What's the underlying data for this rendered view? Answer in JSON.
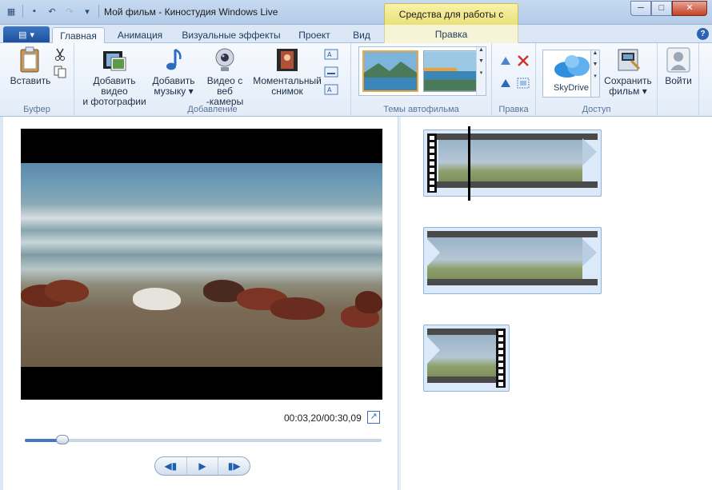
{
  "window": {
    "title": "Мой фильм - Киностудия Windows Live",
    "context_tab_header": "Средства для работы с видео"
  },
  "tabs": [
    {
      "label": "Главная",
      "active": true
    },
    {
      "label": "Анимация"
    },
    {
      "label": "Визуальные эффекты"
    },
    {
      "label": "Проект"
    },
    {
      "label": "Вид"
    },
    {
      "label": "Правка",
      "contextual": true
    }
  ],
  "ribbon": {
    "buffer": {
      "label": "Буфер",
      "paste": "Вставить"
    },
    "add": {
      "label": "Добавление",
      "add_video_1": "Добавить видео",
      "add_video_2": "и фотографии",
      "add_music_1": "Добавить",
      "add_music_2": "музыку ▾",
      "webcam_1": "Видео с веб",
      "webcam_2": "-камеры",
      "snapshot_1": "Моментальный",
      "snapshot_2": "снимок"
    },
    "themes": {
      "label": "Темы автофильма"
    },
    "edit": {
      "label": "Правка"
    },
    "share": {
      "label": "Доступ",
      "skydrive": "SkyDrive",
      "save_1": "Сохранить",
      "save_2": "фильм ▾"
    },
    "signin": {
      "label": "Войти"
    }
  },
  "preview": {
    "timecode": "00:03,20/00:30,09",
    "progress_fraction": 0.105
  },
  "colors": {
    "accent": "#2c63b5",
    "context_tab": "#e9e07a",
    "selection": "#f0a640"
  }
}
